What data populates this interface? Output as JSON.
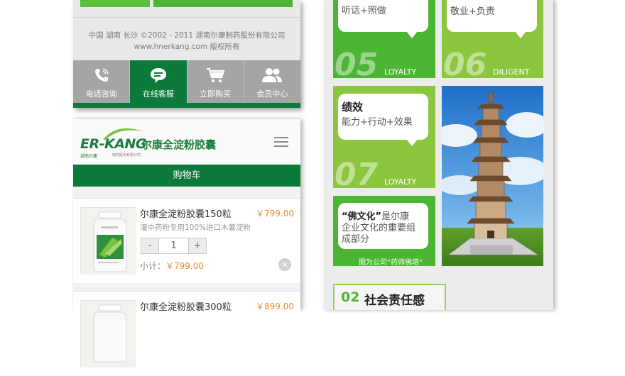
{
  "footer": {
    "copyright_line1": "中国 湖南 长沙 ©2002 - 2011 湖南尔康制药股份有限公司",
    "copyright_line2": "www.hnerkang.com 版权所有"
  },
  "toolbar": {
    "items": [
      {
        "label": "电话咨询",
        "icon": "phone-icon"
      },
      {
        "label": "在线客服",
        "icon": "chat-icon"
      },
      {
        "label": "立即购买",
        "icon": "cart-icon"
      },
      {
        "label": "会员中心",
        "icon": "members-icon"
      }
    ],
    "active_index": 1
  },
  "header": {
    "logo_en": "ER-KANG",
    "logo_cn": "尔康全淀粉胶囊",
    "logo_sub1": "湖南尔康",
    "logo_sub2": "制药股份有限公司",
    "menu_icon": "menu-icon"
  },
  "cart": {
    "title": "购物车",
    "items": [
      {
        "name": "尔康全淀粉胶囊150粒",
        "price": "￥799.00",
        "desc": "灌中药粉专用100%进口木薯淀粉",
        "quantity": "1",
        "minus": "-",
        "plus": "+",
        "subtotal_label": "小计：",
        "subtotal_value": "￥799.00",
        "remove": "×"
      },
      {
        "name": "尔康全淀粉胶囊300粒",
        "price": "￥899.00"
      }
    ]
  },
  "culture": {
    "tile_a": {
      "text": "听话+照做",
      "num": "05",
      "label": "LOYALTY"
    },
    "tile_b": {
      "text": "敬业+负责",
      "num": "06",
      "label": "DILIGENT"
    },
    "tile_c": {
      "title": "绩效",
      "text": "能力+行动+效果",
      "num": "07",
      "label": "LOYALTY"
    },
    "tile_d": {
      "line1_quote": "“佛文化”",
      "line1_rest": "是尔康",
      "line2": "企业文化的重要组",
      "line3": "成部分",
      "caption": "图为公司“药师佛塔”"
    }
  },
  "section": {
    "num": "02",
    "title": "社会责任感"
  },
  "colors": {
    "brand_green": "#0c7a3a",
    "lime": "#4db534",
    "price_orange": "#f08a2a"
  }
}
